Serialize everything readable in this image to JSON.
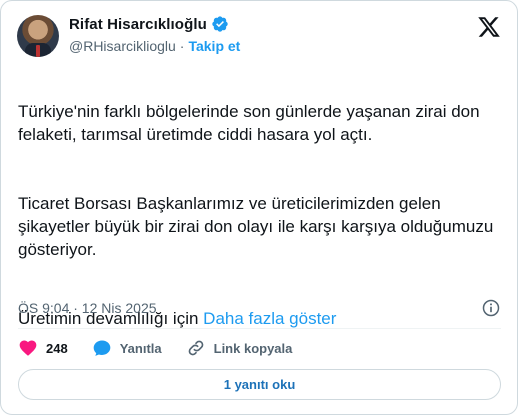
{
  "author": {
    "display_name": "Rifat Hisarcıklıoğlu",
    "handle": "@RHisarciklioglu",
    "separator": "·",
    "follow_label": "Takip et",
    "verified": true
  },
  "tweet": {
    "paragraphs": [
      "Türkiye'nin farklı bölgelerinde son günlerde yaşanan zirai don felaketi, tarımsal üretimde ciddi hasara yol açtı.",
      "Ticaret Borsası Başkanlarımız ve üreticilerimizden gelen şikayetler büyük bir zirai don olayı ile karşı karşıya olduğumuzu gösteriyor."
    ],
    "truncated_line": "Üretimin devamlılığı için ",
    "show_more_label": "Daha fazla göster",
    "timestamp": "ÖS 9:04 · 12 Nis 2025"
  },
  "actions": {
    "like_count": "248",
    "reply_label": "Yanıtla",
    "copy_link_label": "Link kopyala"
  },
  "footer": {
    "read_replies_label": "1 yanıtı oku"
  },
  "colors": {
    "accent": "#1d9bf0",
    "like": "#f91880",
    "muted": "#536471",
    "text": "#0f1419"
  },
  "icons": [
    "verified-badge-icon",
    "x-logo-icon",
    "info-icon",
    "heart-icon",
    "reply-bubble-icon",
    "link-icon"
  ]
}
